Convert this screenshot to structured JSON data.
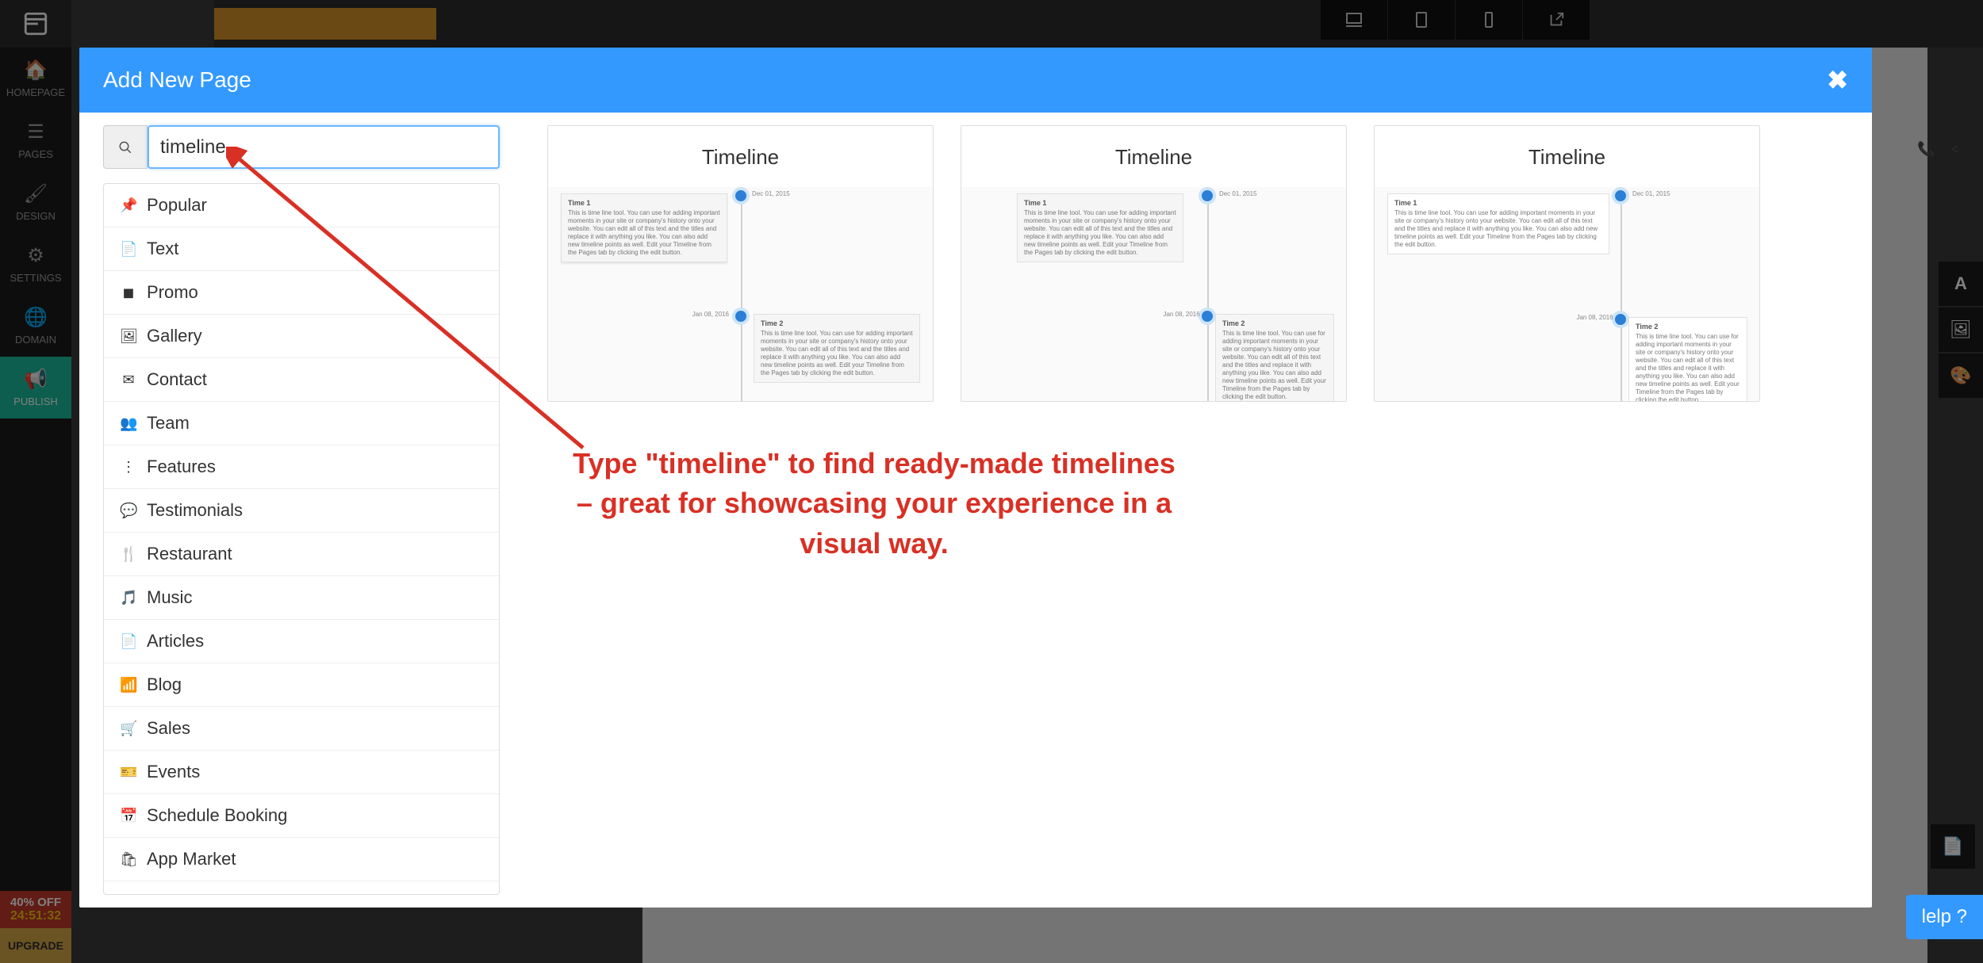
{
  "sidebar": {
    "items": [
      {
        "label": "HOMEPAGE"
      },
      {
        "label": "PAGES"
      },
      {
        "label": "DESIGN"
      },
      {
        "label": "SETTINGS"
      },
      {
        "label": "DOMAIN"
      },
      {
        "label": "PUBLISH"
      }
    ],
    "promo": {
      "line1": "40% OFF",
      "timer": "24:51:32"
    },
    "upgrade": "UPGRADE"
  },
  "modal": {
    "title": "Add New Page",
    "search_value": "timeline",
    "categories": [
      {
        "label": "Popular"
      },
      {
        "label": "Text"
      },
      {
        "label": "Promo"
      },
      {
        "label": "Gallery"
      },
      {
        "label": "Contact"
      },
      {
        "label": "Team"
      },
      {
        "label": "Features"
      },
      {
        "label": "Testimonials"
      },
      {
        "label": "Restaurant"
      },
      {
        "label": "Music"
      },
      {
        "label": "Articles"
      },
      {
        "label": "Blog"
      },
      {
        "label": "Sales"
      },
      {
        "label": "Events"
      },
      {
        "label": "Schedule Booking"
      },
      {
        "label": "App Market"
      }
    ],
    "templates": [
      {
        "title": "Timeline",
        "node1_date": "Dec 01, 2015",
        "node2_date": "Jan 08, 2016",
        "item1_title": "Time 1",
        "item1_body": "This is time line tool. You can use for adding important moments in your site or company's history onto your website. You can edit all of this text and the titles and replace it with anything you like. You can also add new timeline points as well. Edit your Timeline from the Pages tab by clicking the edit button.",
        "item2_title": "Time 2",
        "item2_body": "This is time line tool. You can use for adding important moments in your site or company's history onto your website. You can edit all of this text and the titles and replace it with anything you like. You can also add new timeline points as well. Edit your Timeline from the Pages tab by clicking the edit button."
      },
      {
        "title": "Timeline",
        "node1_date": "Dec 01, 2015",
        "node2_date": "Jan 08, 2016",
        "item1_title": "Time 1",
        "item1_body": "This is time line tool. You can use for adding important moments in your site or company's history onto your website. You can edit all of this text and the titles and replace it with anything you like. You can also add new timeline points as well. Edit your Timeline from the Pages tab by clicking the edit button.",
        "item2_title": "Time 2",
        "item2_body": "This is time line tool. You can use for adding important moments in your site or company's history onto your website. You can edit all of this text and the titles and replace it with anything you like. You can also add new timeline points as well. Edit your Timeline from the Pages tab by clicking the edit button."
      },
      {
        "title": "Timeline",
        "node1_date": "Dec 01, 2015",
        "node2_date": "Jan 08, 2016",
        "item1_title": "Time 1",
        "item1_body": "This is time line tool. You can use for adding important moments in your site or company's history onto your website. You can edit all of this text and the titles and replace it with anything you like. You can also add new timeline points as well. Edit your Timeline from the Pages tab by clicking the edit button.",
        "item2_title": "Time 2",
        "item2_body": "This is time line tool. You can use for adding important moments in your site or company's history onto your website. You can edit all of this text and the titles and replace it with anything you like. You can also add new timeline points as well. Edit your Timeline from the Pages tab by clicking the edit button."
      }
    ]
  },
  "annotation": {
    "text": "Type \"timeline\" to find ready-made timelines – great for showcasing your experience in a visual way."
  },
  "help": {
    "label": "lelp ?"
  }
}
